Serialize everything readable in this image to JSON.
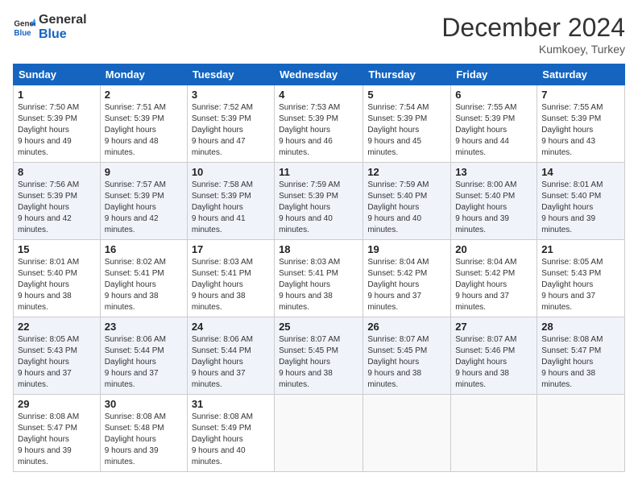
{
  "header": {
    "logo_line1": "General",
    "logo_line2": "Blue",
    "month_title": "December 2024",
    "subtitle": "Kumkoey, Turkey"
  },
  "weekdays": [
    "Sunday",
    "Monday",
    "Tuesday",
    "Wednesday",
    "Thursday",
    "Friday",
    "Saturday"
  ],
  "weeks": [
    [
      {
        "day": "1",
        "sunrise": "7:50 AM",
        "sunset": "5:39 PM",
        "daylight": "9 hours and 49 minutes."
      },
      {
        "day": "2",
        "sunrise": "7:51 AM",
        "sunset": "5:39 PM",
        "daylight": "9 hours and 48 minutes."
      },
      {
        "day": "3",
        "sunrise": "7:52 AM",
        "sunset": "5:39 PM",
        "daylight": "9 hours and 47 minutes."
      },
      {
        "day": "4",
        "sunrise": "7:53 AM",
        "sunset": "5:39 PM",
        "daylight": "9 hours and 46 minutes."
      },
      {
        "day": "5",
        "sunrise": "7:54 AM",
        "sunset": "5:39 PM",
        "daylight": "9 hours and 45 minutes."
      },
      {
        "day": "6",
        "sunrise": "7:55 AM",
        "sunset": "5:39 PM",
        "daylight": "9 hours and 44 minutes."
      },
      {
        "day": "7",
        "sunrise": "7:55 AM",
        "sunset": "5:39 PM",
        "daylight": "9 hours and 43 minutes."
      }
    ],
    [
      {
        "day": "8",
        "sunrise": "7:56 AM",
        "sunset": "5:39 PM",
        "daylight": "9 hours and 42 minutes."
      },
      {
        "day": "9",
        "sunrise": "7:57 AM",
        "sunset": "5:39 PM",
        "daylight": "9 hours and 42 minutes."
      },
      {
        "day": "10",
        "sunrise": "7:58 AM",
        "sunset": "5:39 PM",
        "daylight": "9 hours and 41 minutes."
      },
      {
        "day": "11",
        "sunrise": "7:59 AM",
        "sunset": "5:39 PM",
        "daylight": "9 hours and 40 minutes."
      },
      {
        "day": "12",
        "sunrise": "7:59 AM",
        "sunset": "5:40 PM",
        "daylight": "9 hours and 40 minutes."
      },
      {
        "day": "13",
        "sunrise": "8:00 AM",
        "sunset": "5:40 PM",
        "daylight": "9 hours and 39 minutes."
      },
      {
        "day": "14",
        "sunrise": "8:01 AM",
        "sunset": "5:40 PM",
        "daylight": "9 hours and 39 minutes."
      }
    ],
    [
      {
        "day": "15",
        "sunrise": "8:01 AM",
        "sunset": "5:40 PM",
        "daylight": "9 hours and 38 minutes."
      },
      {
        "day": "16",
        "sunrise": "8:02 AM",
        "sunset": "5:41 PM",
        "daylight": "9 hours and 38 minutes."
      },
      {
        "day": "17",
        "sunrise": "8:03 AM",
        "sunset": "5:41 PM",
        "daylight": "9 hours and 38 minutes."
      },
      {
        "day": "18",
        "sunrise": "8:03 AM",
        "sunset": "5:41 PM",
        "daylight": "9 hours and 38 minutes."
      },
      {
        "day": "19",
        "sunrise": "8:04 AM",
        "sunset": "5:42 PM",
        "daylight": "9 hours and 37 minutes."
      },
      {
        "day": "20",
        "sunrise": "8:04 AM",
        "sunset": "5:42 PM",
        "daylight": "9 hours and 37 minutes."
      },
      {
        "day": "21",
        "sunrise": "8:05 AM",
        "sunset": "5:43 PM",
        "daylight": "9 hours and 37 minutes."
      }
    ],
    [
      {
        "day": "22",
        "sunrise": "8:05 AM",
        "sunset": "5:43 PM",
        "daylight": "9 hours and 37 minutes."
      },
      {
        "day": "23",
        "sunrise": "8:06 AM",
        "sunset": "5:44 PM",
        "daylight": "9 hours and 37 minutes."
      },
      {
        "day": "24",
        "sunrise": "8:06 AM",
        "sunset": "5:44 PM",
        "daylight": "9 hours and 37 minutes."
      },
      {
        "day": "25",
        "sunrise": "8:07 AM",
        "sunset": "5:45 PM",
        "daylight": "9 hours and 38 minutes."
      },
      {
        "day": "26",
        "sunrise": "8:07 AM",
        "sunset": "5:45 PM",
        "daylight": "9 hours and 38 minutes."
      },
      {
        "day": "27",
        "sunrise": "8:07 AM",
        "sunset": "5:46 PM",
        "daylight": "9 hours and 38 minutes."
      },
      {
        "day": "28",
        "sunrise": "8:08 AM",
        "sunset": "5:47 PM",
        "daylight": "9 hours and 38 minutes."
      }
    ],
    [
      {
        "day": "29",
        "sunrise": "8:08 AM",
        "sunset": "5:47 PM",
        "daylight": "9 hours and 39 minutes."
      },
      {
        "day": "30",
        "sunrise": "8:08 AM",
        "sunset": "5:48 PM",
        "daylight": "9 hours and 39 minutes."
      },
      {
        "day": "31",
        "sunrise": "8:08 AM",
        "sunset": "5:49 PM",
        "daylight": "9 hours and 40 minutes."
      },
      null,
      null,
      null,
      null
    ]
  ]
}
